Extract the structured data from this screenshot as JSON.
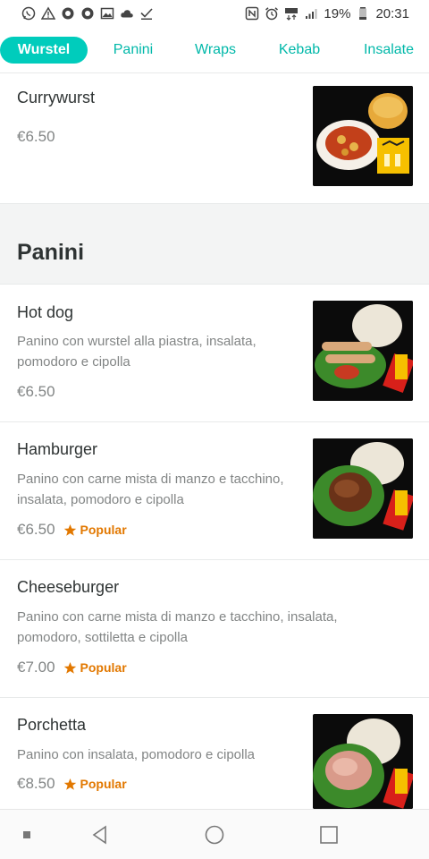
{
  "status_bar": {
    "battery": "19%",
    "time": "20:31",
    "left_icons": [
      "whatsapp-icon",
      "warning-icon",
      "circle-app-icon",
      "circle-app-icon",
      "image-icon",
      "cloud-icon",
      "check-icon"
    ],
    "right_icons": [
      "nfc-icon",
      "alarm-icon",
      "data-4g-icon",
      "signal-icon",
      "battery-icon"
    ]
  },
  "tabs": [
    {
      "label": "Wurstel",
      "active": true
    },
    {
      "label": "Panini",
      "active": false
    },
    {
      "label": "Wraps",
      "active": false
    },
    {
      "label": "Kebab",
      "active": false
    },
    {
      "label": "Insalate",
      "active": false
    }
  ],
  "items_before_section": [
    {
      "name": "Currywurst",
      "description": "",
      "price": "€6.50",
      "popular": false
    }
  ],
  "section": {
    "title": "Panini"
  },
  "items": [
    {
      "name": "Hot dog",
      "description": "Panino con wurstel alla piastra, insalata, pomodoro e cipolla",
      "price": "€6.50",
      "popular": false
    },
    {
      "name": "Hamburger",
      "description": "Panino con carne mista di manzo e tacchino, insalata, pomodoro e cipolla",
      "price": "€6.50",
      "popular": true
    },
    {
      "name": "Cheeseburger",
      "description": "Panino con carne mista di manzo e tacchino, insalata, pomodoro, sottiletta e cipolla",
      "price": "€7.00",
      "popular": true
    },
    {
      "name": "Porchetta",
      "description": "Panino con insalata, pomodoro e cipolla",
      "price": "€8.50",
      "popular": true
    }
  ],
  "popular_label": "Popular",
  "colors": {
    "accent": "#00ccbc",
    "popular": "#e27800",
    "muted_text": "#828585"
  },
  "nav_bar": [
    "square-dot-icon",
    "back-icon",
    "home-icon",
    "recents-icon"
  ]
}
